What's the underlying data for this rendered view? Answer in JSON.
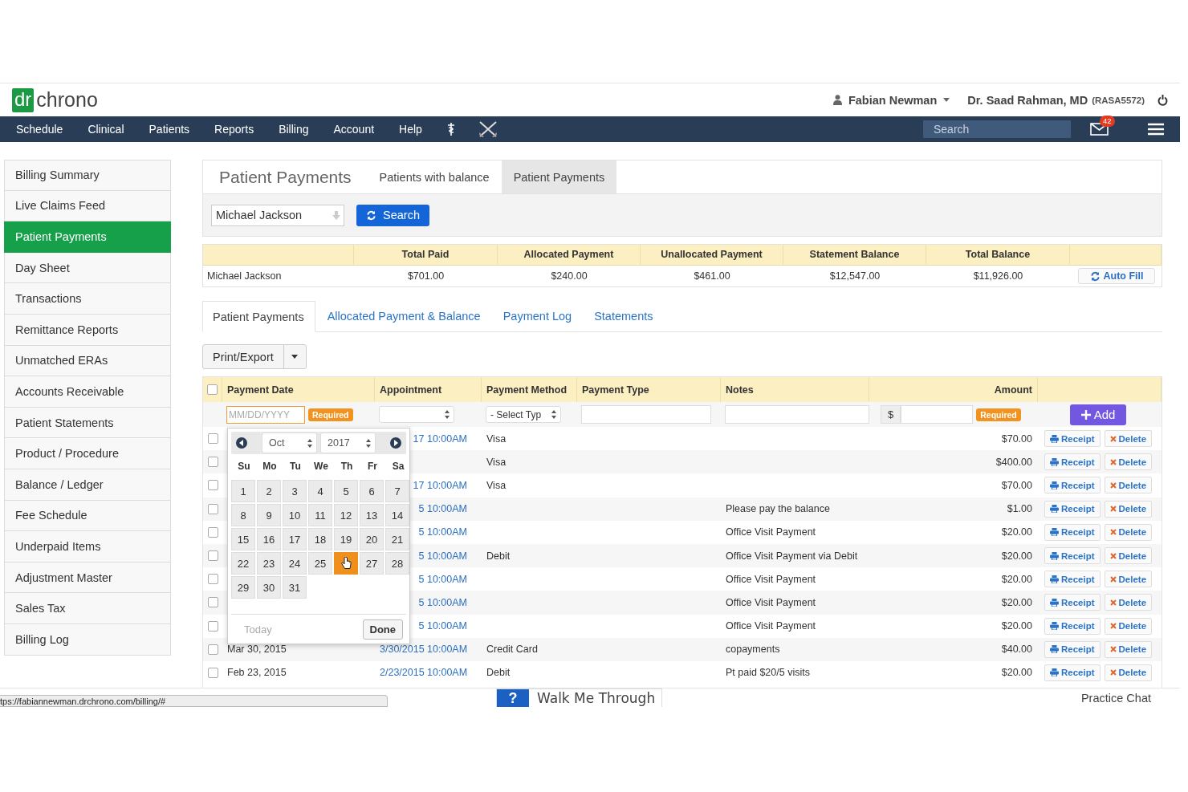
{
  "header": {
    "logo": {
      "mark": "dr",
      "word": "chrono"
    },
    "user": "Fabian Newman",
    "doctor": "Dr. Saad Rahman, MD",
    "doctor_id": "(RASA5572)"
  },
  "nav": {
    "items": [
      "Schedule",
      "Clinical",
      "Patients",
      "Reports",
      "Billing",
      "Account",
      "Help"
    ],
    "search": {
      "placeholder": "Search"
    },
    "mail_count": "42"
  },
  "sidebar": {
    "items": [
      {
        "label": "Billing Summary",
        "selected": false
      },
      {
        "label": "Live Claims Feed",
        "selected": false
      },
      {
        "label": "Patient Payments",
        "selected": true
      },
      {
        "label": "Day Sheet",
        "selected": false
      },
      {
        "label": "Transactions",
        "selected": false
      },
      {
        "label": "Remittance Reports",
        "selected": false
      },
      {
        "label": "Unmatched ERAs",
        "selected": false
      },
      {
        "label": "Accounts Receivable",
        "selected": false
      },
      {
        "label": "Patient Statements",
        "selected": false
      },
      {
        "label": "Product / Procedure",
        "selected": false
      },
      {
        "label": "Balance / Ledger",
        "selected": false
      },
      {
        "label": "Fee Schedule",
        "selected": false
      },
      {
        "label": "Underpaid Items",
        "selected": false
      },
      {
        "label": "Adjustment Master",
        "selected": false
      },
      {
        "label": "Sales Tax",
        "selected": false
      },
      {
        "label": "Billing Log",
        "selected": false
      }
    ]
  },
  "panel": {
    "title": "Patient Payments",
    "tabs": [
      {
        "label": "Patients with balance",
        "selected": false
      },
      {
        "label": "Patient Payments",
        "selected": true
      }
    ],
    "patient_select": {
      "value": "Michael Jackson"
    },
    "search_button": "Search"
  },
  "summary": {
    "columns": [
      "Total Paid",
      "Allocated Payment",
      "Unallocated Payment",
      "Statement Balance",
      "Total Balance"
    ],
    "row": {
      "name": "Michael Jackson",
      "values": [
        "$701.00",
        "$240.00",
        "$461.00",
        "$12,547.00",
        "$11,926.00"
      ]
    },
    "auto_fill": "Auto Fill"
  },
  "subtabs": [
    {
      "label": "Patient Payments",
      "selected": true
    },
    {
      "label": "Allocated Payment & Balance",
      "selected": false
    },
    {
      "label": "Payment Log",
      "selected": false
    },
    {
      "label": "Statements",
      "selected": false
    }
  ],
  "print_export": "Print/Export",
  "payments": {
    "all_checked": false,
    "columns": [
      "Payment Date",
      "Appointment",
      "Payment Method",
      "Payment Type",
      "Notes",
      "Amount"
    ],
    "new_row": {
      "date_placeholder": "MM/DD/YYYY",
      "date_required": "Required",
      "type_select": "- Select Typ",
      "currency": "$",
      "amount_required": "Required",
      "add": "Add"
    },
    "rows": [
      {
        "checked": false,
        "appointment": "17 10:00AM",
        "method": "Visa",
        "amount": "$70.00",
        "receipt": "Receipt",
        "delete": "Delete"
      },
      {
        "checked": false,
        "method": "Visa",
        "amount": "$400.00",
        "receipt": "Receipt",
        "delete": "Delete"
      },
      {
        "checked": false,
        "appointment": "17 10:00AM",
        "method": "Visa",
        "amount": "$70.00",
        "receipt": "Receipt",
        "delete": "Delete"
      },
      {
        "checked": false,
        "appointment": "5 10:00AM",
        "notes": "Please pay the balance",
        "amount": "$1.00",
        "receipt": "Receipt",
        "delete": "Delete"
      },
      {
        "checked": false,
        "appointment": "5 10:00AM",
        "notes": "Office Visit Payment",
        "amount": "$20.00",
        "receipt": "Receipt",
        "delete": "Delete"
      },
      {
        "checked": false,
        "appointment": "5 10:00AM",
        "method": "Debit",
        "notes": "Office Visit Payment via Debit",
        "amount": "$20.00",
        "receipt": "Receipt",
        "delete": "Delete"
      },
      {
        "checked": false,
        "appointment": "5 10:00AM",
        "notes": "Office Visit Payment",
        "amount": "$20.00",
        "receipt": "Receipt",
        "delete": "Delete"
      },
      {
        "checked": false,
        "appointment": "5 10:00AM",
        "notes": "Office Visit Payment",
        "amount": "$20.00",
        "receipt": "Receipt",
        "delete": "Delete"
      },
      {
        "checked": false,
        "appointment": "5 10:00AM",
        "notes": "Office Visit Payment",
        "amount": "$20.00",
        "receipt": "Receipt",
        "delete": "Delete"
      },
      {
        "checked": false,
        "date": "Mar 30, 2015",
        "appointment": "3/30/2015 10:00AM",
        "method": "Credit Card",
        "notes": "copayments",
        "amount": "$40.00",
        "receipt": "Receipt",
        "delete": "Delete"
      },
      {
        "checked": false,
        "date": "Feb 23, 2015",
        "appointment": "2/23/2015 10:00AM",
        "method": "Debit",
        "notes": "Pt paid $20/5 visits",
        "amount": "$20.00",
        "receipt": "Receipt",
        "delete": "Delete"
      }
    ]
  },
  "datepicker": {
    "month": "Oct",
    "year": "2017",
    "weekdays": [
      "Su",
      "Mo",
      "Tu",
      "We",
      "Th",
      "Fr",
      "Sa"
    ],
    "days": [
      {
        "label": "1",
        "selected": false
      },
      {
        "label": "2",
        "selected": false
      },
      {
        "label": "3",
        "selected": false
      },
      {
        "label": "4",
        "selected": false
      },
      {
        "label": "5",
        "selected": false
      },
      {
        "label": "6",
        "selected": false
      },
      {
        "label": "7",
        "selected": false
      },
      {
        "label": "8",
        "selected": false
      },
      {
        "label": "9",
        "selected": false
      },
      {
        "label": "10",
        "selected": false
      },
      {
        "label": "11",
        "selected": false
      },
      {
        "label": "12",
        "selected": false
      },
      {
        "label": "13",
        "selected": false
      },
      {
        "label": "14",
        "selected": false
      },
      {
        "label": "15",
        "selected": false
      },
      {
        "label": "16",
        "selected": false
      },
      {
        "label": "17",
        "selected": false
      },
      {
        "label": "18",
        "selected": false
      },
      {
        "label": "19",
        "selected": false
      },
      {
        "label": "20",
        "selected": false
      },
      {
        "label": "21",
        "selected": false
      },
      {
        "label": "22",
        "selected": false
      },
      {
        "label": "23",
        "selected": false
      },
      {
        "label": "24",
        "selected": false
      },
      {
        "label": "25",
        "selected": false
      },
      {
        "selected": true
      },
      {
        "label": "27",
        "selected": false
      },
      {
        "label": "28",
        "selected": false
      },
      {
        "label": "29",
        "selected": false
      },
      {
        "label": "30",
        "selected": false
      },
      {
        "label": "31",
        "selected": false
      }
    ],
    "today": {
      "label": "Today",
      "disabled": true
    },
    "done": "Done"
  },
  "footer": {
    "walkme_icon": "?",
    "walkme": "Walk Me Through",
    "chat": "Practice Chat"
  },
  "status_url": "tps://fabiannewman.drchrono.com/billing/#"
}
